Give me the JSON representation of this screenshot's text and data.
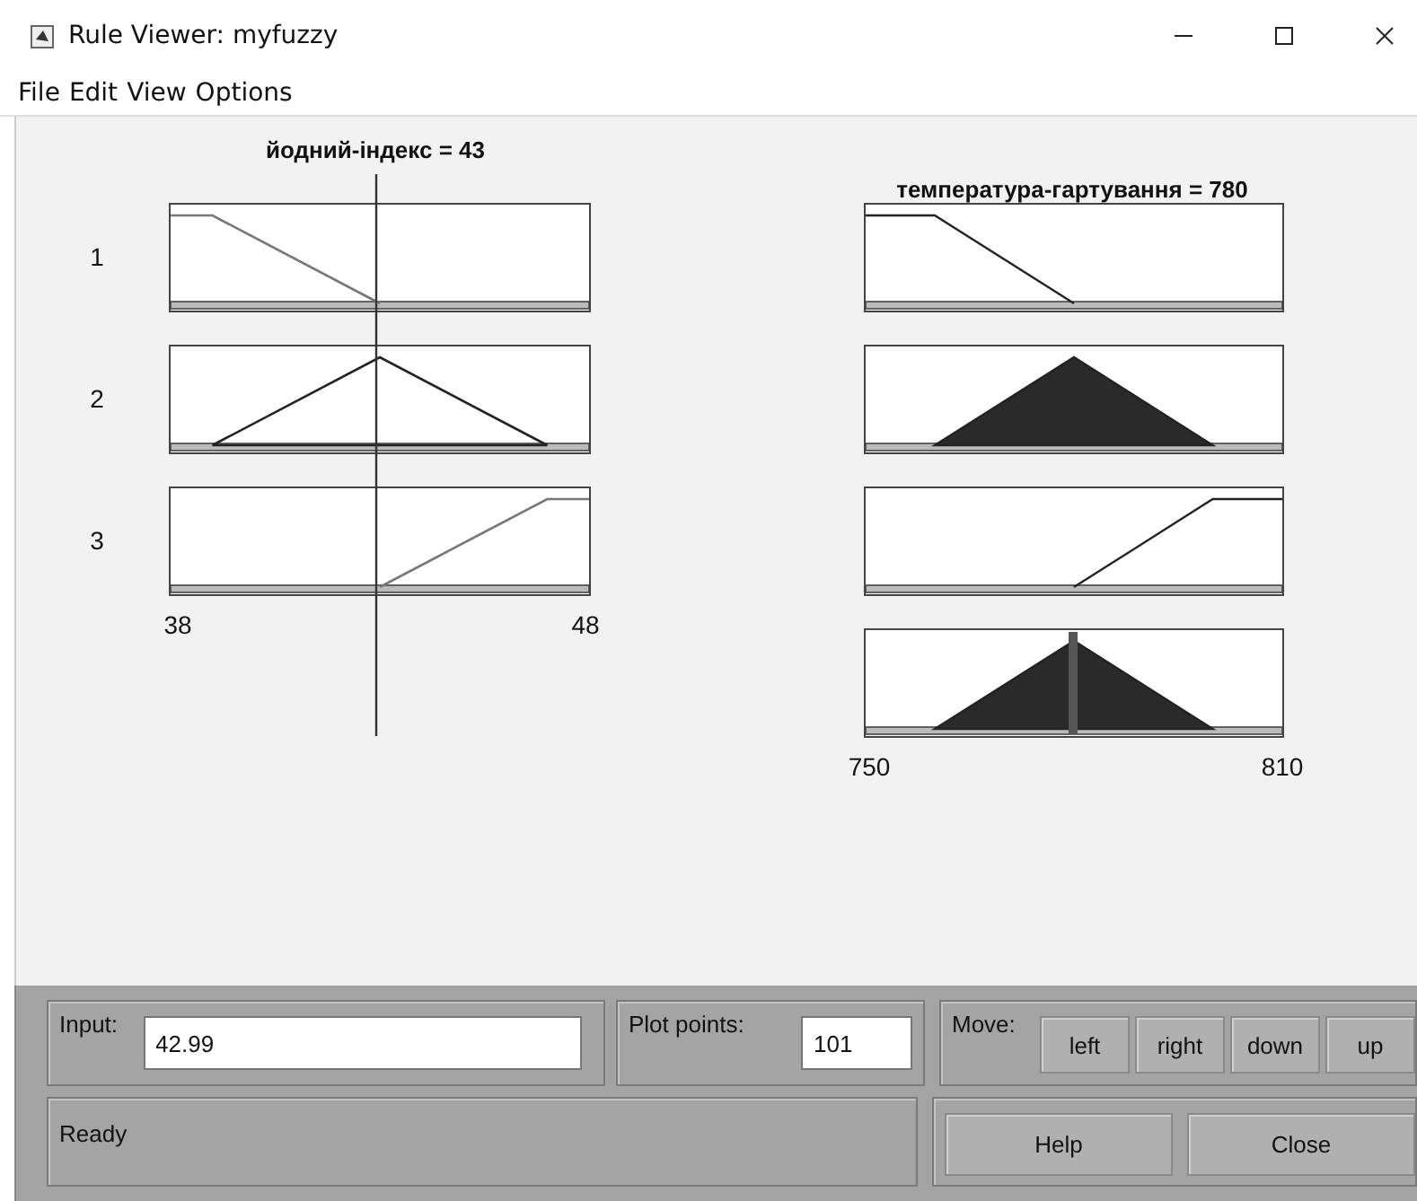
{
  "window": {
    "title": "Rule Viewer: myfuzzy"
  },
  "menu": [
    "File",
    "Edit",
    "View",
    "Options"
  ],
  "input_plot": {
    "title": "йодний-індекс = 43",
    "axis_min": "38",
    "axis_max": "48",
    "rules": [
      {
        "number": "1",
        "kind": "falling"
      },
      {
        "number": "2",
        "kind": "peak"
      },
      {
        "number": "3",
        "kind": "rising"
      }
    ]
  },
  "output_plot": {
    "title": "температура-гартування = 780",
    "axis_min": "750",
    "axis_max": "810",
    "panels": [
      {
        "kind": "falling",
        "filled": false
      },
      {
        "kind": "peak",
        "filled": true
      },
      {
        "kind": "rising",
        "filled": false
      },
      {
        "kind": "sum",
        "filled": true
      }
    ]
  },
  "input_field": {
    "label": "Input:",
    "value": "42.99"
  },
  "plot_points": {
    "label": "Plot points:",
    "value": "101"
  },
  "move": {
    "label": "Move:",
    "buttons": [
      "left",
      "right",
      "down",
      "up"
    ]
  },
  "status": "Ready",
  "buttons": [
    "Help",
    "Close"
  ]
}
